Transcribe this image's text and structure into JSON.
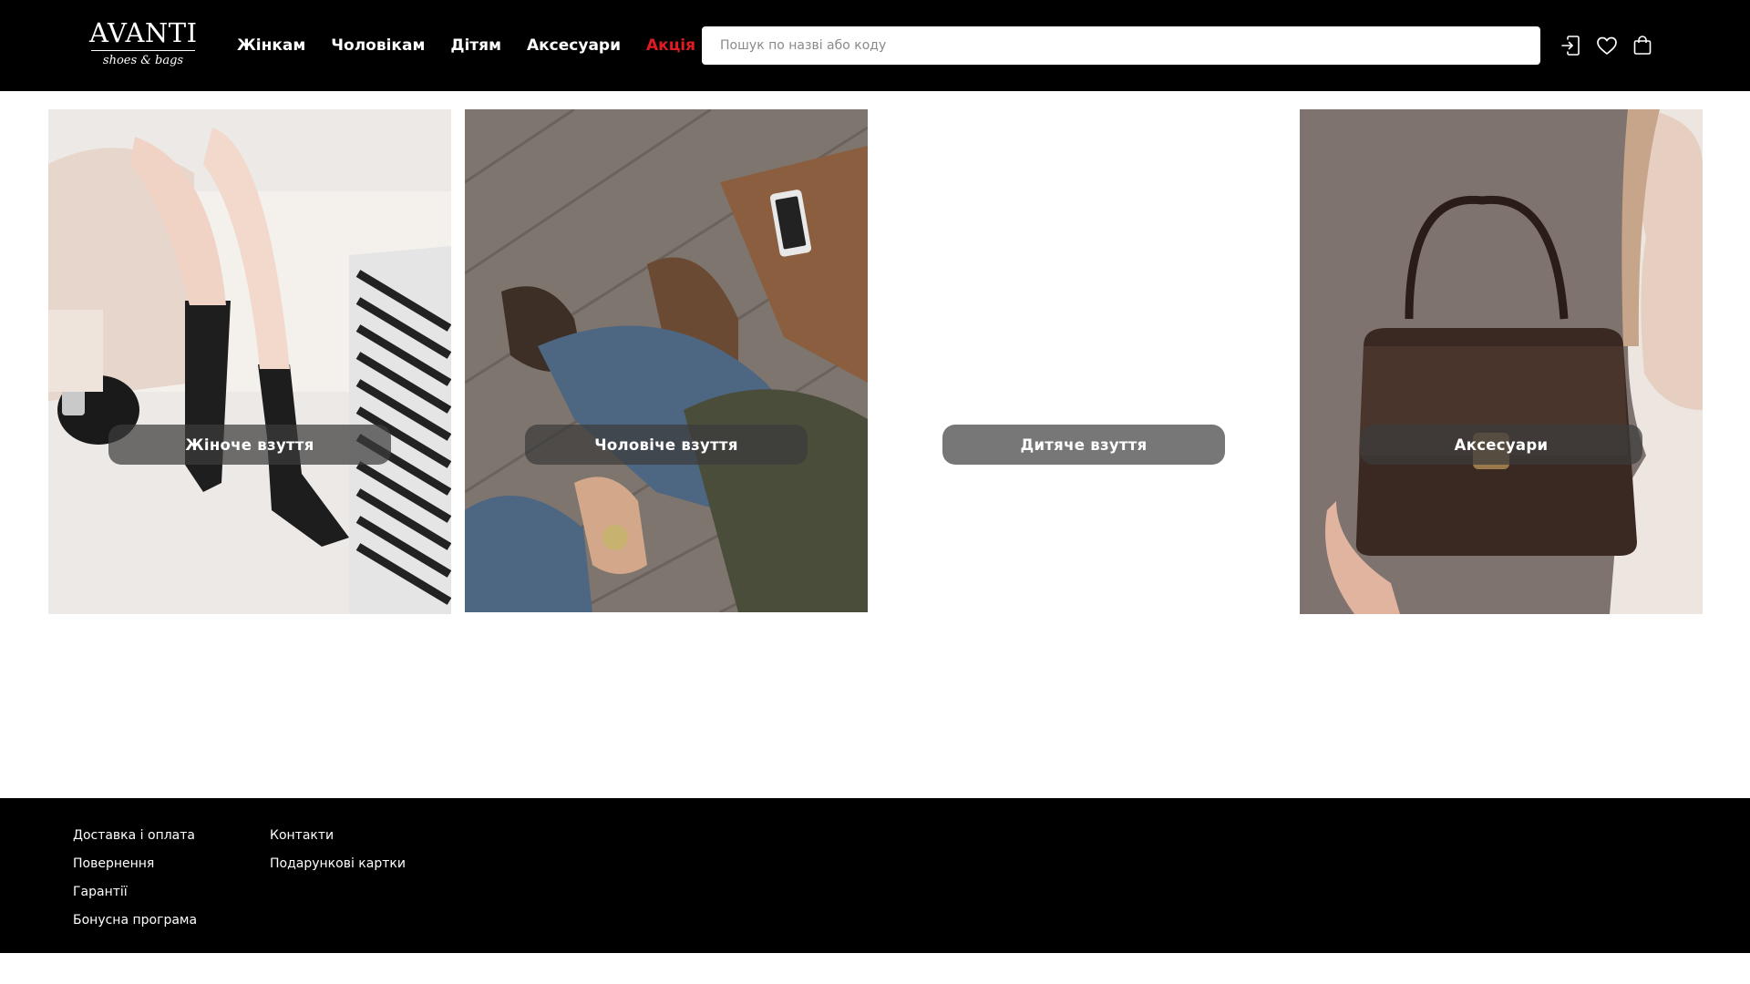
{
  "header": {
    "logo": {
      "main": "AVANTI",
      "sub": "shoes & bags"
    },
    "nav": [
      {
        "label": "Жінкам"
      },
      {
        "label": "Чоловікам"
      },
      {
        "label": "Дітям"
      },
      {
        "label": "Аксесуари"
      },
      {
        "label": "Акція"
      }
    ],
    "search": {
      "placeholder": "Пошук по назві або коду",
      "value": ""
    },
    "icons": [
      "login-icon",
      "heart-icon",
      "shopping-bag-icon"
    ],
    "sale_color": "#e01b24"
  },
  "categories": [
    {
      "label": "Жіноче взуття"
    },
    {
      "label": "Чоловіче взуття"
    },
    {
      "label": "Дитяче взуття"
    },
    {
      "label": "Аксесуари"
    }
  ],
  "footer": {
    "col1": [
      "Доставка і оплата",
      "Повернення",
      "Гарантії",
      "Бонусна програма"
    ],
    "col2": [
      "Контакти",
      "Подарункові картки"
    ]
  }
}
